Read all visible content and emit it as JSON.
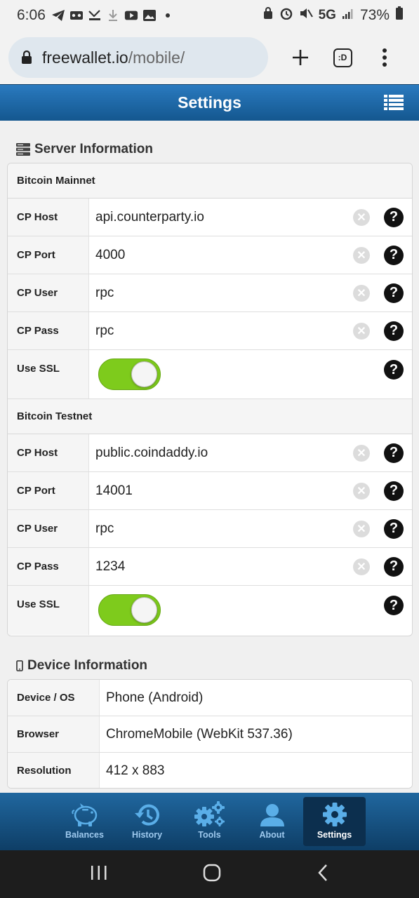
{
  "status_bar": {
    "time": "6:06",
    "network": "5G",
    "battery": "73%"
  },
  "browser": {
    "url_host": "freewallet.io",
    "url_path": "/mobile/",
    "tab_switcher_label": ":D"
  },
  "header": {
    "title": "Settings"
  },
  "server_info": {
    "title": "Server Information",
    "groups": [
      {
        "name": "Bitcoin Mainnet",
        "host_label": "CP Host",
        "host": "api.counterparty.io",
        "port_label": "CP Port",
        "port": "4000",
        "user_label": "CP User",
        "user": "rpc",
        "pass_label": "CP Pass",
        "pass": "rpc",
        "ssl_label": "Use SSL",
        "ssl": "on"
      },
      {
        "name": "Bitcoin Testnet",
        "host_label": "CP Host",
        "host": "public.coindaddy.io",
        "port_label": "CP Port",
        "port": "14001",
        "user_label": "CP User",
        "user": "rpc",
        "pass_label": "CP Pass",
        "pass": "1234",
        "ssl_label": "Use SSL",
        "ssl": "on"
      }
    ]
  },
  "device_info": {
    "title": "Device Information",
    "rows": [
      {
        "label": "Device / OS",
        "value": "Phone (Android)"
      },
      {
        "label": "Browser",
        "value": "ChromeMobile (WebKit 537.36)"
      },
      {
        "label": "Resolution",
        "value": "412 x 883"
      }
    ]
  },
  "bottom_nav": {
    "items": [
      {
        "label": "Balances",
        "icon": "piggy-bank-icon"
      },
      {
        "label": "History",
        "icon": "history-icon"
      },
      {
        "label": "Tools",
        "icon": "gears-icon"
      },
      {
        "label": "About",
        "icon": "user-icon"
      },
      {
        "label": "Settings",
        "icon": "gear-icon",
        "active": true
      }
    ]
  },
  "colors": {
    "header_blue": "#1f6aa8",
    "toggle_green": "#7ecb1c",
    "nav_active": "#0c2f4e"
  }
}
